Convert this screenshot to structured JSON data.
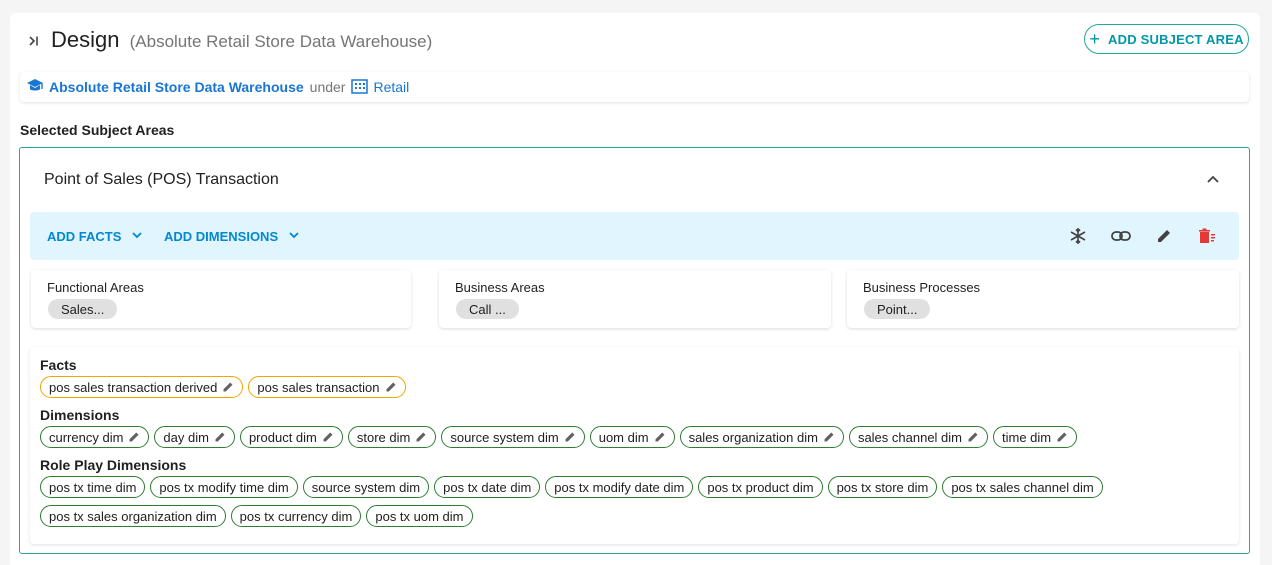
{
  "header": {
    "title": "Design",
    "subtitle": "(Absolute Retail Store Data Warehouse)",
    "add_subject_area_label": "ADD SUBJECT AREA"
  },
  "breadcrumb": {
    "warehouse": "Absolute Retail Store Data Warehouse",
    "under": "under",
    "parent": "Retail"
  },
  "selected_label": "Selected Subject Areas",
  "subject": {
    "title": "Point of Sales (POS) Transaction",
    "add_facts_label": "ADD FACTS",
    "add_dimensions_label": "ADD DIMENSIONS",
    "areas": [
      {
        "label": "Functional Areas",
        "chip": "Sales..."
      },
      {
        "label": "Business Areas",
        "chip": "Call ..."
      },
      {
        "label": "Business Processes",
        "chip": "Point..."
      }
    ],
    "facts_label": "Facts",
    "facts": [
      "pos sales transaction derived",
      "pos sales transaction"
    ],
    "dimensions_label": "Dimensions",
    "dimensions": [
      "currency dim",
      "day dim",
      "product dim",
      "store dim",
      "source system dim",
      "uom dim",
      "sales organization dim",
      "sales channel dim",
      "time dim"
    ],
    "role_play_label": "Role Play Dimensions",
    "role_play_row1": [
      "pos tx time dim",
      "pos tx modify time dim",
      "source system dim",
      "pos tx date dim",
      "pos tx modify date dim",
      "pos tx product dim",
      "pos tx store dim",
      "pos tx sales channel dim"
    ],
    "role_play_row2": [
      "pos tx sales organization dim",
      "pos tx currency dim",
      "pos tx uom dim"
    ]
  },
  "colors": {
    "accent": "#0288d1",
    "teal_border": "#26a69a",
    "fact_border": "#f0a500",
    "dim_border": "#2e7d32",
    "delete": "#e53935"
  }
}
